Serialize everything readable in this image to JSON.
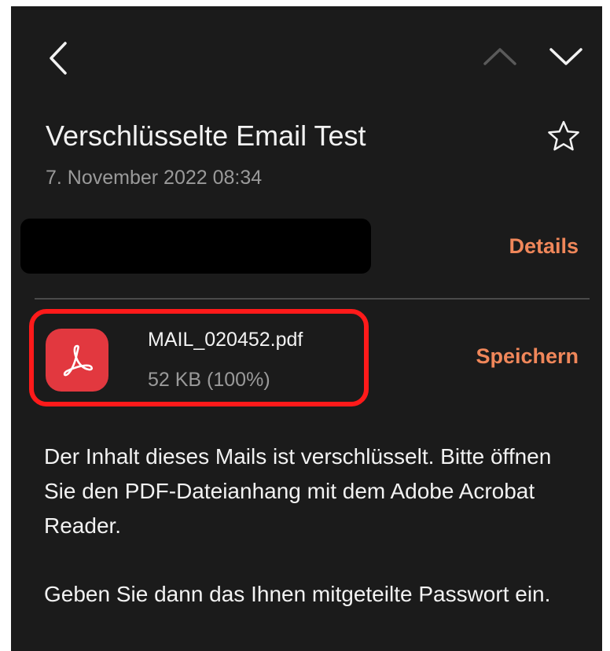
{
  "nav": {
    "back_icon": "chevron-left-icon",
    "prev_icon": "chevron-up-icon",
    "next_icon": "chevron-down-icon"
  },
  "mail": {
    "subject": "Verschlüsselte Email Test",
    "star_icon": "star-outline-icon",
    "date": "7. November 2022  08:34",
    "details_label": "Details"
  },
  "attachment": {
    "icon": "pdf-icon",
    "file_name": "MAIL_020452.pdf",
    "file_size": "52 KB (100%)",
    "save_label": "Speichern"
  },
  "body": {
    "paragraph1": "Der Inhalt dieses Mails ist verschlüsselt. Bitte öffnen Sie den PDF-Dateianhang mit dem Adobe Acrobat Reader.",
    "paragraph2": "Geben Sie dann das Ihnen mitgeteilte Passwort ein."
  },
  "colors": {
    "background": "#1b1b1b",
    "accent": "#f0875a",
    "highlight_border": "#ff1a1a",
    "pdf_red": "#e2383f"
  }
}
